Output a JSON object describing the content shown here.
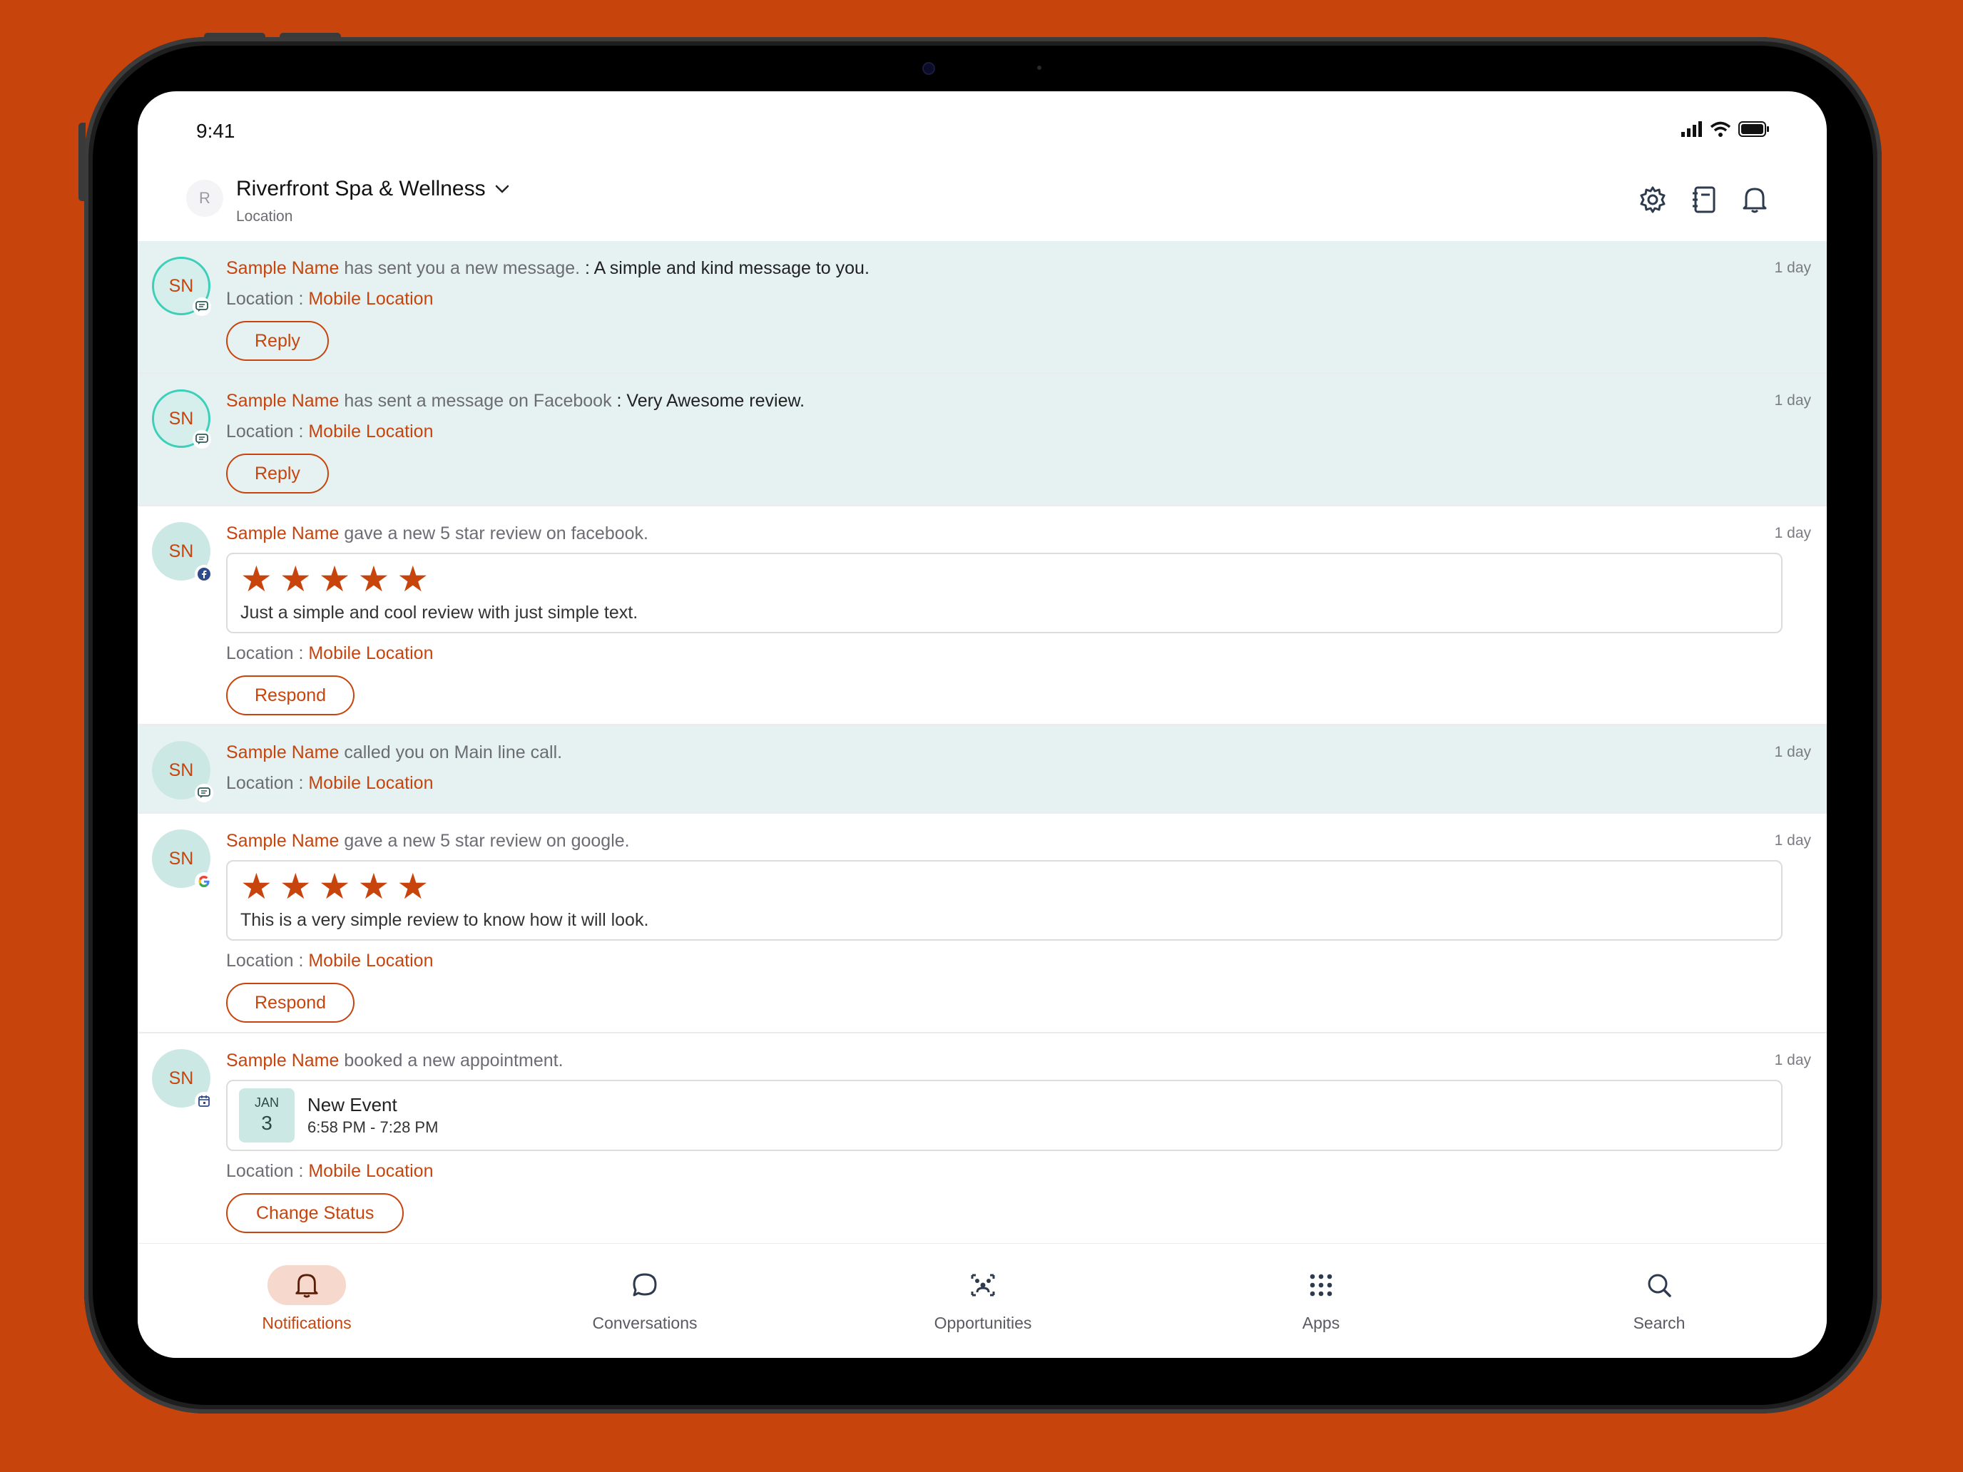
{
  "status_bar": {
    "time": "9:41"
  },
  "header": {
    "avatar_initial": "R",
    "location_name": "Riverfront Spa & Wellness",
    "location_label": "Location"
  },
  "notifications": [
    {
      "initials": "SN",
      "badge": "chat-icon",
      "name": "Sample Name",
      "action": " has sent you a new message.",
      "message": " : A simple and kind message to you.",
      "time_ago": "1 day",
      "location_label": "Location : ",
      "location_value": "Mobile Location",
      "button": "Reply"
    },
    {
      "initials": "SN",
      "badge": "chat-icon",
      "name": "Sample Name",
      "action": " has sent a message on Facebook",
      "message": " : Very Awesome review.",
      "time_ago": "1 day",
      "location_label": "Location : ",
      "location_value": "Mobile Location",
      "button": "Reply"
    },
    {
      "initials": "SN",
      "badge": "facebook-icon",
      "name": "Sample Name",
      "action": " gave a new 5 star review on facebook.",
      "rating": 5,
      "review_text": "Just a simple and cool review with just simple text.",
      "time_ago": "1 day",
      "location_label": "Location : ",
      "location_value": "Mobile Location",
      "button": "Respond"
    },
    {
      "initials": "SN",
      "badge": "chat-icon",
      "name": "Sample Name",
      "action": " called you on Main line call.",
      "time_ago": "1 day",
      "location_label": "Location : ",
      "location_value": "Mobile Location"
    },
    {
      "initials": "SN",
      "badge": "google-icon",
      "name": "Sample Name",
      "action": " gave a new 5 star review on google.",
      "rating": 5,
      "review_text": "This is a very simple review to know how it will look.",
      "time_ago": "1 day",
      "location_label": "Location : ",
      "location_value": "Mobile Location",
      "button": "Respond"
    },
    {
      "initials": "SN",
      "badge": "calendar-icon",
      "name": "Sample Name",
      "action": " booked a new appointment.",
      "event": {
        "month": "JAN",
        "day": "3",
        "title": "New Event",
        "time": "6:58 PM - 7:28 PM"
      },
      "time_ago": "1 day",
      "location_label": "Location : ",
      "location_value": "Mobile Location",
      "button": "Change Status"
    }
  ],
  "tabs": [
    {
      "label": "Notifications",
      "icon": "bell-icon",
      "active": true
    },
    {
      "label": "Conversations",
      "icon": "chat-bubble-icon"
    },
    {
      "label": "Opportunities",
      "icon": "opportunities-icon"
    },
    {
      "label": "Apps",
      "icon": "apps-grid-icon"
    },
    {
      "label": "Search",
      "icon": "search-icon"
    }
  ],
  "colors": {
    "accent": "#c8440d",
    "tint_row": "#e5f2f1",
    "avatar_bg": "#cce8e5",
    "ring": "#3ccfb9"
  }
}
